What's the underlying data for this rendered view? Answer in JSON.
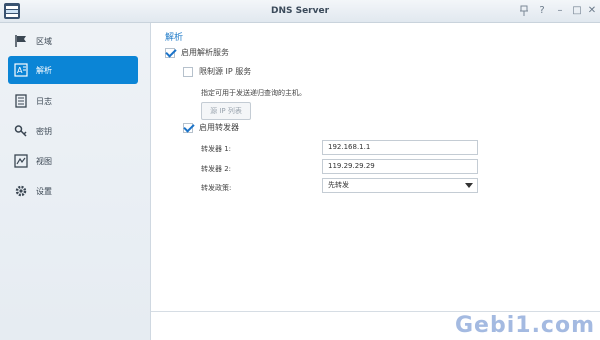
{
  "window": {
    "title": "DNS Server"
  },
  "titlebar": {
    "pin_icon": "pin-icon",
    "help_label": "?",
    "minimize_label": "–",
    "maximize_label": "□",
    "close_label": "✕"
  },
  "sidebar": {
    "items": [
      {
        "label": "区域",
        "icon": "flag-icon",
        "active": false
      },
      {
        "label": "解析",
        "icon": "resolve-icon",
        "active": true
      },
      {
        "label": "日志",
        "icon": "log-icon",
        "active": false
      },
      {
        "label": "密钥",
        "icon": "key-icon",
        "active": false
      },
      {
        "label": "视图",
        "icon": "view-icon",
        "active": false
      },
      {
        "label": "设置",
        "icon": "gear-icon",
        "active": false
      }
    ]
  },
  "main": {
    "section_title": "解析",
    "enable_resolve": {
      "label": "启用解析服务",
      "checked": true
    },
    "limit_source": {
      "label": "限制源 IP 服务",
      "checked": false
    },
    "hint": "指定可用于发送递归查询的主机。",
    "source_ip_button": "源 IP 列表",
    "enable_forwarder": {
      "label": "启用转发器",
      "checked": true
    },
    "forwarder1": {
      "label": "转发器 1:",
      "value": "192.168.1.1"
    },
    "forwarder2": {
      "label": "转发器 2:",
      "value": "119.29.29.29"
    },
    "policy": {
      "label": "转发政策:",
      "value": "先转发"
    }
  },
  "watermark": {
    "text": "Gebi1.com"
  }
}
